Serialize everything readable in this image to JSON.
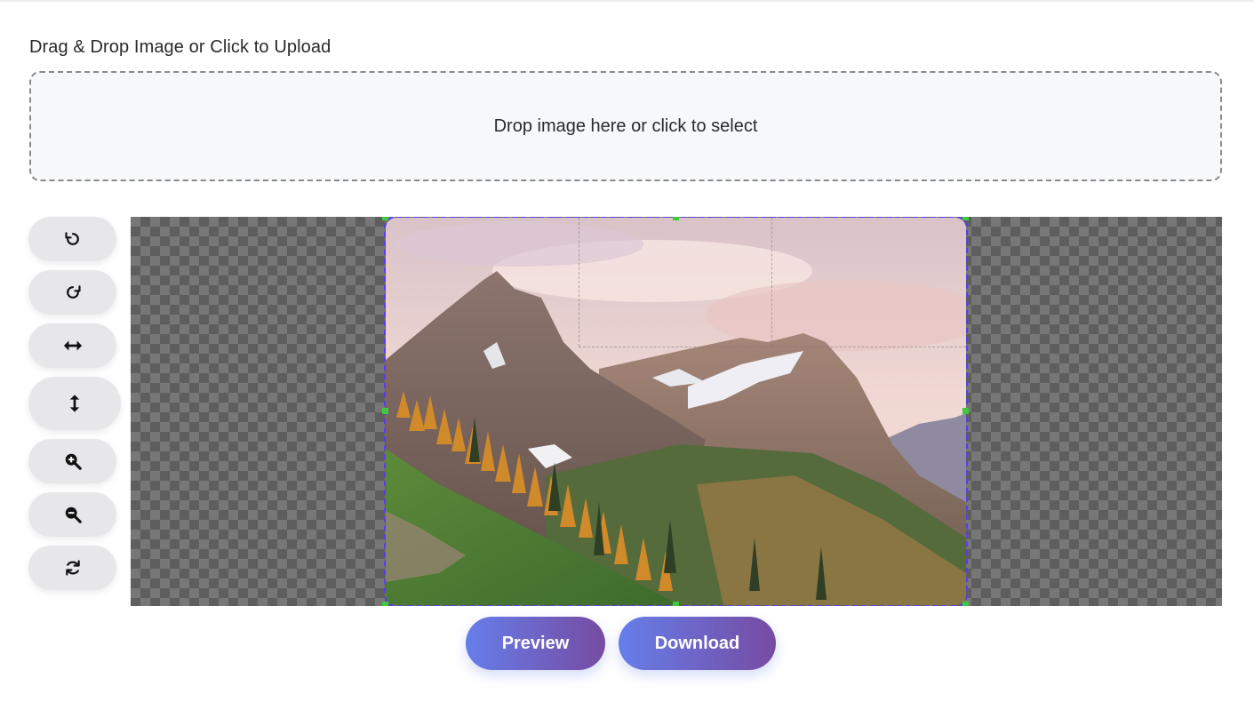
{
  "upload": {
    "label": "Drag & Drop Image or Click to Upload",
    "dropzone_text": "Drop image here or click to select"
  },
  "toolbar": {
    "buttons": [
      {
        "name": "rotate-left",
        "icon": "rotate-left-icon"
      },
      {
        "name": "rotate-right",
        "icon": "rotate-right-icon"
      },
      {
        "name": "flip-horizontal",
        "icon": "flip-horizontal-icon"
      },
      {
        "name": "flip-vertical",
        "icon": "flip-vertical-icon"
      },
      {
        "name": "zoom-in",
        "icon": "zoom-in-icon"
      },
      {
        "name": "zoom-out",
        "icon": "zoom-out-icon"
      },
      {
        "name": "reset",
        "icon": "reset-icon"
      }
    ]
  },
  "editor": {
    "image_subject": "mountain landscape photo",
    "crop_outline_color": "#5a3df0",
    "handle_color": "#3ec93e"
  },
  "actions": {
    "preview_label": "Preview",
    "download_label": "Download",
    "gradient_start": "#667eea",
    "gradient_end": "#764ba2"
  }
}
